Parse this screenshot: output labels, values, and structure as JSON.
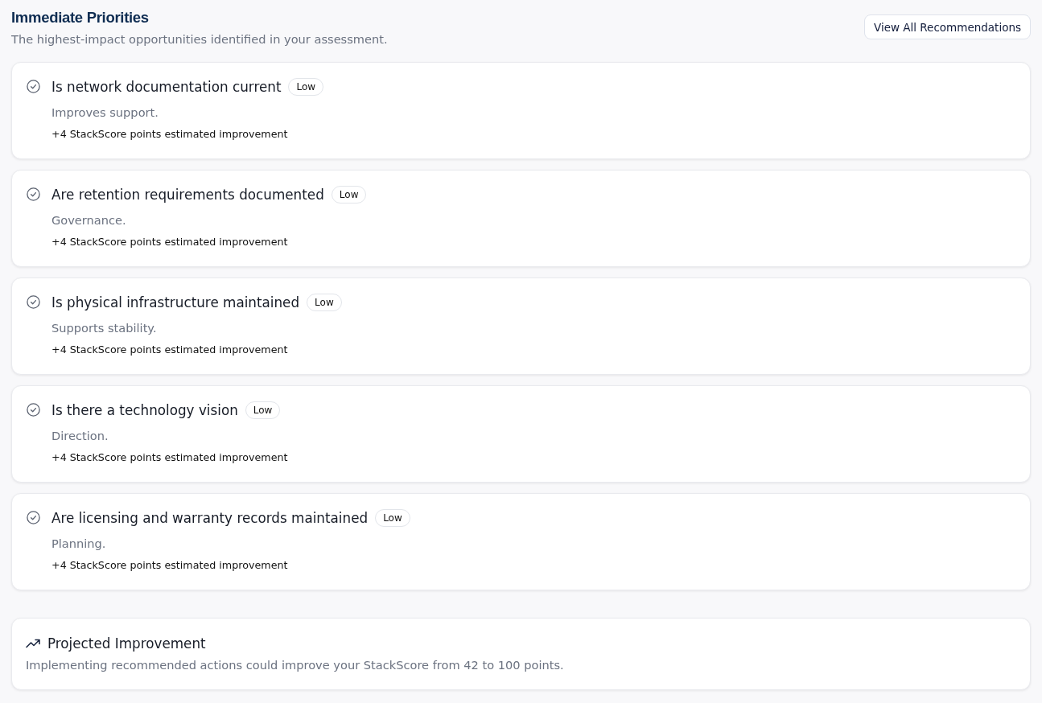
{
  "header": {
    "title": "Immediate Priorities",
    "subtitle": "The highest-impact opportunities identified in your assessment.",
    "button": "View All Recommendations"
  },
  "priorities": [
    {
      "title": "Is network documentation current",
      "badge": "Low",
      "description": "Improves support.",
      "impact": "+4 StackScore points estimated improvement"
    },
    {
      "title": "Are retention requirements documented",
      "badge": "Low",
      "description": "Governance.",
      "impact": "+4 StackScore points estimated improvement"
    },
    {
      "title": "Is physical infrastructure maintained",
      "badge": "Low",
      "description": "Supports stability.",
      "impact": "+4 StackScore points estimated improvement"
    },
    {
      "title": "Is there a technology vision",
      "badge": "Low",
      "description": "Direction.",
      "impact": "+4 StackScore points estimated improvement"
    },
    {
      "title": "Are licensing and warranty records maintained",
      "badge": "Low",
      "description": "Planning.",
      "impact": "+4 StackScore points estimated improvement"
    }
  ],
  "projection": {
    "title": "Projected Improvement",
    "text": "Implementing recommended actions could improve your StackScore from 42 to 100 points."
  }
}
